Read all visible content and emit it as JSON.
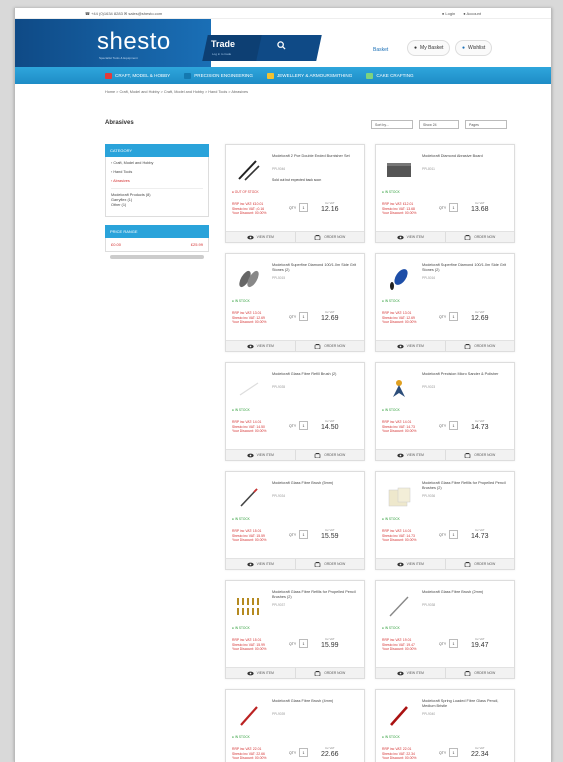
{
  "topbar": {
    "phone": "☎ +44 (0)1634 8283 ✉ sales@shesto.com",
    "login": "● Login",
    "account": "● Account"
  },
  "header": {
    "logo": "shesto",
    "logo_tagline": "Specialist Tools & Equipment",
    "trade": "Trade",
    "trade_sub": "Log in to trade",
    "search_icon": "search-icon",
    "link": "Basket",
    "basket_btn": "My Basket",
    "wishlist_btn": "Wishlist"
  },
  "nav": {
    "items": [
      {
        "label": "CRAFT, MODEL & HOBBY",
        "color": "#e23b3b"
      },
      {
        "label": "PRECISION ENGINEERING",
        "color": "#2fa6dc"
      },
      {
        "label": "JEWELLERY & ARMOURSMITHING",
        "color": "#f2c230"
      },
      {
        "label": "CAKE CRAFTING",
        "color": "#7ed37e"
      }
    ]
  },
  "breadcrumb": "Home > Craft, Model and Hobby > Craft, Model and Hobby > Hand Tools > Abrasives",
  "page_title": "Abrasives",
  "sort": {
    "option1": "Sort by...",
    "option2": "Show 24",
    "option3": "Pages"
  },
  "sidebar": {
    "categories_head": "CATEGORY",
    "items": [
      "‹ Craft, Model and Hobby",
      "‹ Hand Tools",
      "‹ Abrasives"
    ],
    "brand_lines": [
      "Modelcraft Products (8)",
      "Garryflex (1)",
      "Other (1)"
    ],
    "price_head": "PRICE RANGE",
    "price_min": "£0.00",
    "price_max": "£25.99"
  },
  "products": [
    {
      "title": "Modelcraft 2 Pce Double Ended Burnisher Set",
      "code": "PPL9046",
      "note": "Sold out but expected back soon",
      "stock": "● OUT OF STOCK",
      "stock_red": true,
      "prices": [
        "RRP inc VAT: £10.01",
        "Shesto inc VAT: ¡0.16",
        "Your Discount: 00.00%"
      ],
      "price": "12.16"
    },
    {
      "title": "Modelcraft Diamond Abrasive Board",
      "code": "PPL8011",
      "note": "",
      "stock": "● IN STOCK",
      "stock_red": false,
      "prices": [
        "RRP inc VAT: £12.01",
        "Shesto inc VAT: 13.68",
        "Your Discount: 00.00%"
      ],
      "price": "13.68"
    },
    {
      "title": "Modelcraft Superfine Diamond 100/1.0m Side Grit Stones (2)",
      "code": "PPL5015",
      "note": "",
      "stock": "● IN STOCK",
      "stock_red": false,
      "prices": [
        "RRP inc VAT: 13.01",
        "Shesto inc VAT: 12.69",
        "Your Discount: 00.00%"
      ],
      "price": "12.69"
    },
    {
      "title": "Modelcraft Superfine Diamond 100/1.0m Side Grit Stones (2)",
      "code": "PPL5016",
      "note": "",
      "stock": "● IN STOCK",
      "stock_red": false,
      "prices": [
        "RRP inc VAT: 13.01",
        "Shesto inc VAT: 12.69",
        "Your Discount: 00.00%"
      ],
      "price": "12.69"
    },
    {
      "title": "Modelcraft Glass Fibre Refill Brush (2)",
      "code": "PPL9035",
      "note": "",
      "stock": "● IN STOCK",
      "stock_red": false,
      "prices": [
        "RRP inc VAT: 14.01",
        "Shesto inc VAT: 14.50",
        "Your Discount: 00.00%"
      ],
      "price": "14.50"
    },
    {
      "title": "Modelcraft Precision Micro Sander & Polisher",
      "code": "PPL9023",
      "note": "",
      "stock": "● IN STOCK",
      "stock_red": false,
      "prices": [
        "RRP inc VAT: 14.01",
        "Shesto inc VAT: 14.73",
        "Your Discount: 00.00%"
      ],
      "price": "14.73"
    },
    {
      "title": "Modelcraft Glass Fibre Brush (5mm)",
      "code": "PPL9034",
      "note": "",
      "stock": "● IN STOCK",
      "stock_red": false,
      "prices": [
        "RRP inc VAT: 15.01",
        "Shesto inc VAT: 15.59",
        "Your Discount: 00.00%"
      ],
      "price": "15.59"
    },
    {
      "title": "Modelcraft Glass Fibre Refills for Propelled Pencil Brushes (2)",
      "code": "PPL9036",
      "note": "",
      "stock": "● IN STOCK",
      "stock_red": false,
      "prices": [
        "RRP inc VAT: 14.01",
        "Shesto inc VAT: 14.73",
        "Your Discount: 00.00%"
      ],
      "price": "14.73"
    },
    {
      "title": "Modelcraft Glass Fibre Refills for Propelled Pencil Brushes (2)",
      "code": "PPL9037",
      "note": "",
      "stock": "● IN STOCK",
      "stock_red": false,
      "prices": [
        "RRP inc VAT: 15.01",
        "Shesto inc VAT: 15.99",
        "Your Discount: 00.00%"
      ],
      "price": "15.99"
    },
    {
      "title": "Modelcraft Glass Fibre Brush (2mm)",
      "code": "PPL9038",
      "note": "",
      "stock": "● IN STOCK",
      "stock_red": false,
      "prices": [
        "RRP inc VAT: 19.01",
        "Shesto inc VAT: 19.47",
        "Your Discount: 00.00%"
      ],
      "price": "19.47"
    },
    {
      "title": "Modelcraft Glass Fibre Brush (4mm)",
      "code": "PPL9039",
      "note": "",
      "stock": "● IN STOCK",
      "stock_red": false,
      "prices": [
        "RRP inc VAT: 22.01",
        "Shesto inc VAT: 22.66",
        "Your Discount: 00.00%"
      ],
      "price": "22.66"
    },
    {
      "title": "Modelcraft Spring Loaded Fibre Glass Pencil, Medium Bristle",
      "code": "PPL9040",
      "note": "",
      "stock": "● IN STOCK",
      "stock_red": false,
      "prices": [
        "RRP inc VAT: 22.01",
        "Shesto inc VAT: 22.34",
        "Your Discount: 00.00%"
      ],
      "price": "22.34"
    }
  ],
  "card_labels": {
    "qty": "QTY",
    "qty_value": "1",
    "inc_vat": "Inc VAT",
    "view": "VIEW ITEM",
    "order": "ORDER NOW"
  }
}
